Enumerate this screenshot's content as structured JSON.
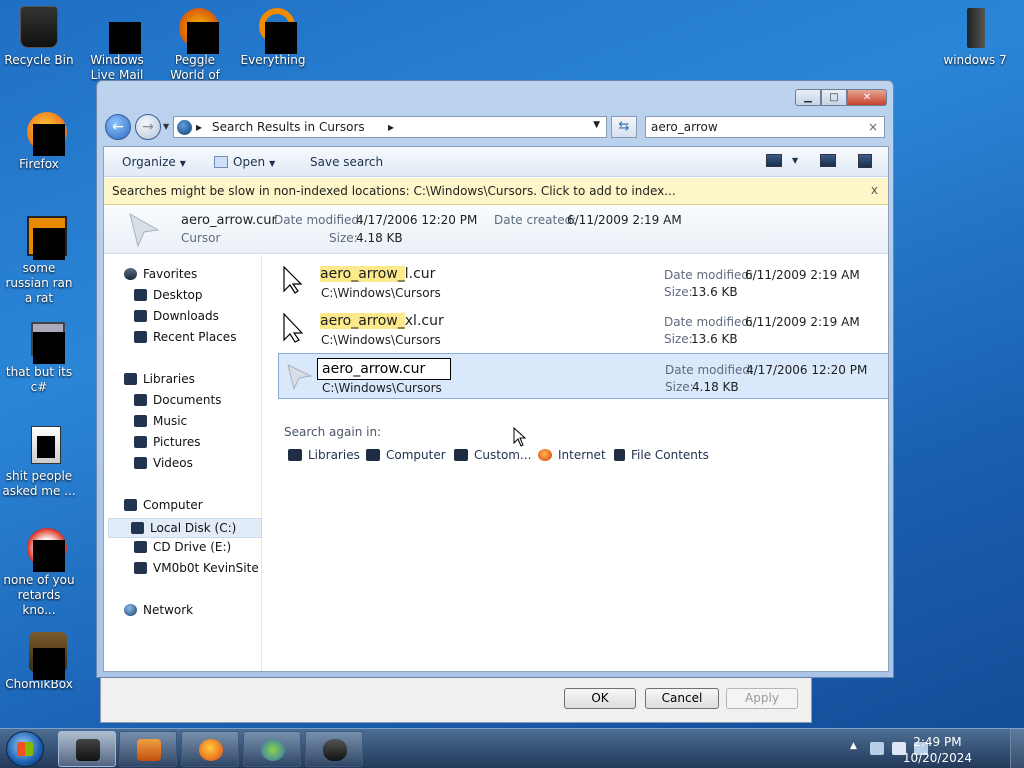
{
  "desktop": {
    "icons": [
      {
        "label": "Recycle Bin"
      },
      {
        "label": "Windows Live Mail"
      },
      {
        "label": "Peggle World of Warcraft"
      },
      {
        "label": "Everything"
      },
      {
        "label": "windows 7"
      },
      {
        "label": "Firefox"
      },
      {
        "label": "some russian ran a rat"
      },
      {
        "label": "that but its c#"
      },
      {
        "label": "shit people asked me ..."
      },
      {
        "label": "none of you retards kno..."
      },
      {
        "label": "ChomikBox"
      }
    ]
  },
  "explorer": {
    "address": {
      "crumb": "Search Results in Cursors",
      "arrow": "▸"
    },
    "search": {
      "value": "aero_arrow",
      "clear": "×"
    },
    "toolbar": {
      "organize": "Organize",
      "open": "Open",
      "save_search": "Save search"
    },
    "infobar": {
      "text": "Searches might be slow in non-indexed locations: C:\\Windows\\Cursors. Click to add to index...",
      "close": "x"
    },
    "details": {
      "name": "aero_arrow.cur",
      "type": "Cursor",
      "modified_label": "Date modified:",
      "modified": "4/17/2006 12:20 PM",
      "created_label": "Date created:",
      "created": "6/11/2009 2:19 AM",
      "size_label": "Size:",
      "size": "4.18 KB"
    },
    "nav": {
      "favorites": "Favorites",
      "desktop": "Desktop",
      "downloads": "Downloads",
      "recent": "Recent Places",
      "libraries": "Libraries",
      "documents": "Documents",
      "music": "Music",
      "pictures": "Pictures",
      "videos": "Videos",
      "computer": "Computer",
      "local_disk": "Local Disk (C:)",
      "cd_drive": "CD Drive (E:)",
      "vm": "VM0b0t KevinSite",
      "network": "Network"
    },
    "results": [
      {
        "name_hl": "aero_arrow_",
        "name_rest": "l.cur",
        "path": "C:\\Windows\\Cursors",
        "mod_label": "Date modified:",
        "modified": "6/11/2009 2:19 AM",
        "size_label": "Size:",
        "size": "13.6 KB"
      },
      {
        "name_hl": "aero_arrow_",
        "name_rest": "xl.cur",
        "path": "C:\\Windows\\Cursors",
        "mod_label": "Date modified:",
        "modified": "6/11/2009 2:19 AM",
        "size_label": "Size:",
        "size": "13.6 KB"
      },
      {
        "rename_value": "aero_arrow.cur",
        "path": "C:\\Windows\\Cursors",
        "mod_label": "Date modified:",
        "modified": "4/17/2006 12:20 PM",
        "size_label": "Size:",
        "size": "4.18 KB"
      }
    ],
    "search_again": {
      "label": "Search again in:",
      "libraries": "Libraries",
      "computer": "Computer",
      "custom": "Custom...",
      "internet": "Internet",
      "file_contents": "File Contents"
    }
  },
  "dialog": {
    "ok": "OK",
    "cancel": "Cancel",
    "apply": "Apply"
  },
  "taskbar": {
    "time": "2:49 PM",
    "date": "10/20/2024"
  }
}
